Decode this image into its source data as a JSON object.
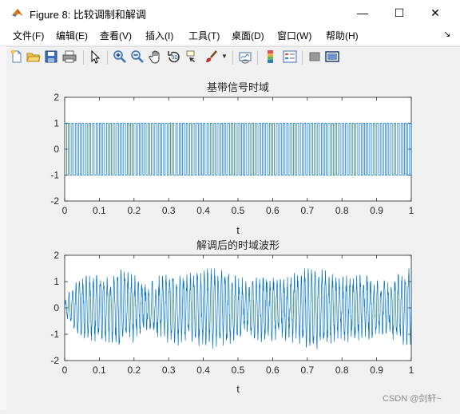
{
  "window": {
    "title": "Figure 8: 比较调制和解调",
    "buttons": {
      "minimize": "—",
      "maximize": "☐",
      "close": "✕"
    }
  },
  "menubar": {
    "items": [
      "文件(F)",
      "编辑(E)",
      "查看(V)",
      "插入(I)",
      "工具(T)",
      "桌面(D)",
      "窗口(W)",
      "帮助(H)"
    ]
  },
  "toolbar": {
    "icons": [
      "new-figure-icon",
      "open-file-icon",
      "save-icon",
      "print-icon",
      "edit-plot-icon",
      "zoom-in-icon",
      "zoom-out-icon",
      "pan-icon",
      "rotate-3d-icon",
      "data-cursor-icon",
      "brush-icon",
      "link-plot-icon",
      "colorbar-icon",
      "legend-icon",
      "hide-plot-tools-icon",
      "show-plot-tools-icon"
    ]
  },
  "colors": {
    "line": "#0072bd",
    "axes_bg": "#ffffff",
    "figure_bg": "#f0f0f0"
  },
  "chart_data": [
    {
      "type": "line",
      "title": "基带信号时域",
      "xlabel": "t",
      "ylabel": "",
      "xlim": [
        0,
        1
      ],
      "ylim": [
        -2,
        2
      ],
      "xticks": [
        "0",
        "0.1",
        "0.2",
        "0.3",
        "0.4",
        "0.5",
        "0.6",
        "0.7",
        "0.8",
        "0.9",
        "1"
      ],
      "yticks": [
        "-2",
        "-1",
        "0",
        "1",
        "2"
      ],
      "grid": false,
      "series": [
        {
          "frequency_hz": 100,
          "amplitude": 1,
          "values_range": [
            -1,
            1
          ]
        }
      ]
    },
    {
      "type": "line",
      "title": "解调后的时域波形",
      "xlabel": "t",
      "ylabel": "",
      "xlim": [
        0,
        1
      ],
      "ylim": [
        -2,
        2
      ],
      "xticks": [
        "0",
        "0.1",
        "0.2",
        "0.3",
        "0.4",
        "0.5",
        "0.6",
        "0.7",
        "0.8",
        "0.9",
        "1"
      ],
      "yticks": [
        "-2",
        "-1",
        "0",
        "1",
        "2"
      ],
      "grid": false,
      "series": [
        {
          "frequency_hz": 100,
          "amplitude_start": 0.2,
          "amplitude_steady": 1.0,
          "values_range": [
            -1.6,
            1.5
          ]
        }
      ]
    }
  ],
  "watermark": "CSDN @剑轩~"
}
